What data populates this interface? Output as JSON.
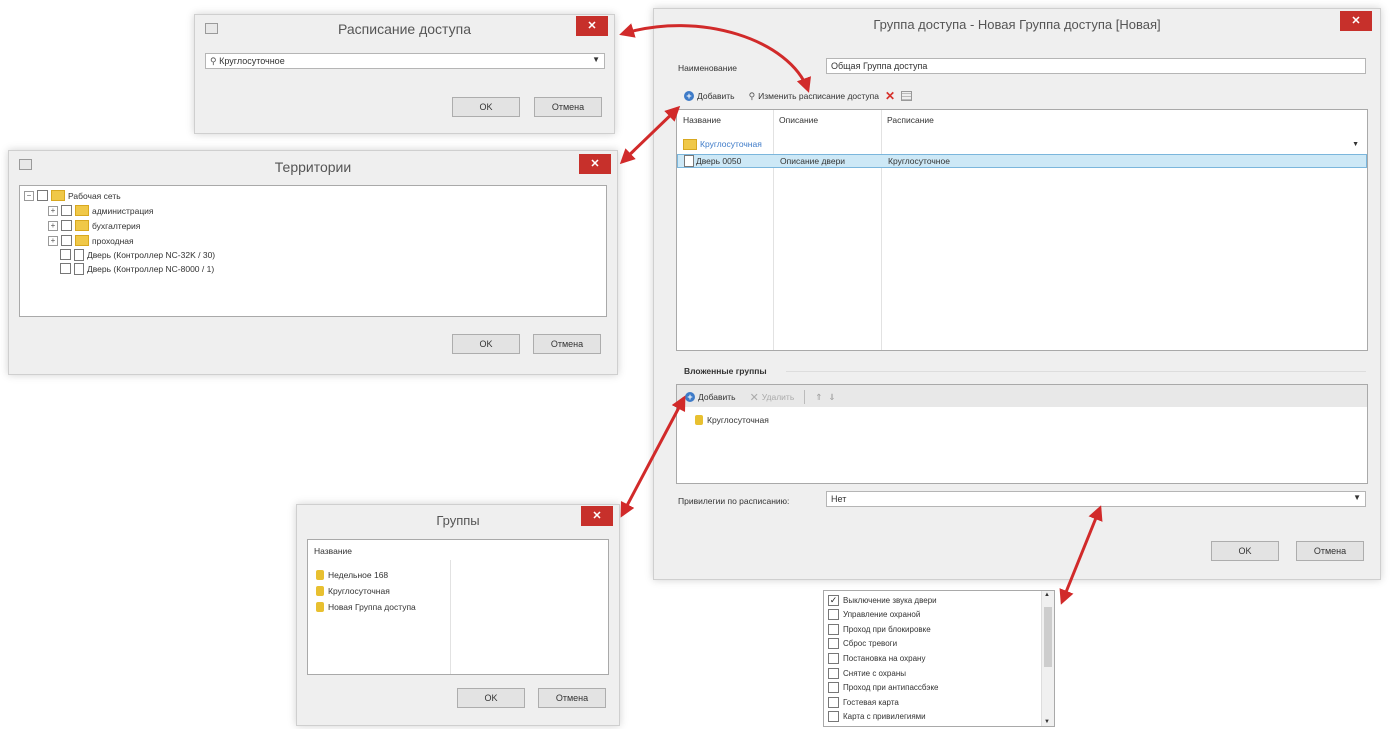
{
  "schedule_dialog": {
    "title": "Расписание доступа",
    "close_glyph": "✕",
    "combo_value": "Круглосуточное",
    "ok": "OK",
    "cancel": "Отмена"
  },
  "territories_dialog": {
    "title": "Территории",
    "close_glyph": "✕",
    "tree": [
      {
        "label": "Рабочая сеть",
        "expander": "−"
      },
      {
        "label": "администрация",
        "expander": "+"
      },
      {
        "label": "бухгалтерия",
        "expander": "+"
      },
      {
        "label": "проходная",
        "expander": "+"
      },
      {
        "label": "Дверь (Контроллер NC-32K / 30)"
      },
      {
        "label": "Дверь (Контроллер NC-8000 / 1)"
      }
    ],
    "ok": "OK",
    "cancel": "Отмена"
  },
  "main_dialog": {
    "title": "Группа доступа - Новая Группа доступа [Новая]",
    "close_glyph": "✕",
    "name_label": "Наименование",
    "name_value": "Общая Группа доступа",
    "toolbar": {
      "add": "Добавить",
      "change_schedule": "Изменить расписание доступа"
    },
    "table": {
      "headers": [
        "Название",
        "Описание",
        "Расписание"
      ],
      "group_row": "Круглосуточная",
      "rows": [
        {
          "name": "Дверь 0050",
          "desc": "Описание двери",
          "schedule": "Круглосуточное"
        }
      ]
    },
    "nested_label": "Вложенные группы",
    "nested_toolbar": {
      "add": "Добавить",
      "delete": "Удалить"
    },
    "nested_items": [
      "Круглосуточная"
    ],
    "schedule_binding_label": "Привилегии по расписанию:",
    "schedule_binding_value": "Нет",
    "ok": "OK",
    "cancel": "Отмена"
  },
  "groups_dialog": {
    "title": "Группы",
    "close_glyph": "✕",
    "header": "Название",
    "items": [
      "Недельное 168",
      "Круглосуточная",
      "Новая Группа доступа"
    ],
    "ok": "OK",
    "cancel": "Отмена"
  },
  "privileges_list": {
    "items": [
      {
        "label": "Выключение звука двери",
        "checked": true
      },
      {
        "label": "Управление охраной",
        "checked": false
      },
      {
        "label": "Проход при блокировке",
        "checked": false
      },
      {
        "label": "Сброс тревоги",
        "checked": false
      },
      {
        "label": "Постановка на охрану",
        "checked": false
      },
      {
        "label": "Снятие с охраны",
        "checked": false
      },
      {
        "label": "Проход при антипассбэке",
        "checked": false
      },
      {
        "label": "Гостевая карта",
        "checked": false
      },
      {
        "label": "Карта с привилегиями",
        "checked": false
      }
    ]
  },
  "colors": {
    "accent": "#3e7bc8",
    "close": "#c7302b",
    "arrow": "#d12a2a",
    "selected_row": "#cde8f6"
  }
}
